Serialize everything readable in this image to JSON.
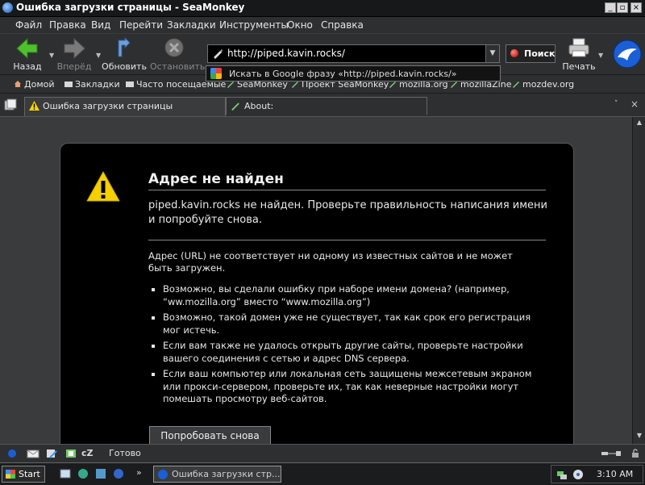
{
  "window": {
    "title": "Ошибка загрузки страницы - SeaMonkey",
    "controls": [
      "_",
      "▫",
      "×"
    ]
  },
  "menu": [
    "Файл",
    "Правка",
    "Вид",
    "Перейти",
    "Закладки",
    "Инструменты",
    "Окно",
    "Справка"
  ],
  "nav": {
    "back": "Назад",
    "forward": "Вперёд",
    "reload": "Обновить",
    "stop": "Остановить",
    "url": "http://piped.kavin.rocks/",
    "search": "Поиск",
    "print": "Печать"
  },
  "url_popup": {
    "text": "Искать в Google фразу «http://piped.kavin.rocks/»"
  },
  "bookmarks": [
    "Домой",
    "Закладки",
    "Часто посещаемые",
    "SeaMonkey",
    "Проект SeaMonkey",
    "mozilla.org",
    "mozillaZine",
    "mozdev.org"
  ],
  "tabs": [
    {
      "label": "Ошибка загрузки страницы",
      "active": true
    },
    {
      "label": "About:",
      "active": false
    }
  ],
  "error": {
    "title": "Адрес не найден",
    "short": "piped.kavin.rocks не найден. Проверьте правильность написания имени и попробуйте снова.",
    "long": "Адрес (URL) не соответствует ни одному из известных сайтов и не может быть загружен.",
    "bullets": [
      "Возможно, вы сделали ошибку при наборе имени домена? (например, “ww.mozilla.org” вместо “www.mozilla.org”)",
      "Возможно, такой домен уже не существует, так как срок его регистрация мог истечь.",
      "Если вам также не удалось открыть другие сайты, проверьте настройки вашего соединения с сетью и адрес DNS сервера.",
      "Если ваш компьютер или локальная сеть защищены межсетевым экраном или прокси-сервером, проверьте их, так как неверные настройки могут помешать просмотру веб-сайтов."
    ],
    "retry": "Попробовать снова"
  },
  "status": {
    "text": "Готово",
    "cz": "cZ"
  },
  "taskbar": {
    "start": "Start",
    "task": "Ошибка загрузки стр...",
    "clock": "3:10 AM",
    "more": "»"
  },
  "colors": {
    "warning_fill": "#f5d000",
    "back_arrow": "#4fbf2f",
    "seamonkey_blue": "#1b5fd6"
  }
}
